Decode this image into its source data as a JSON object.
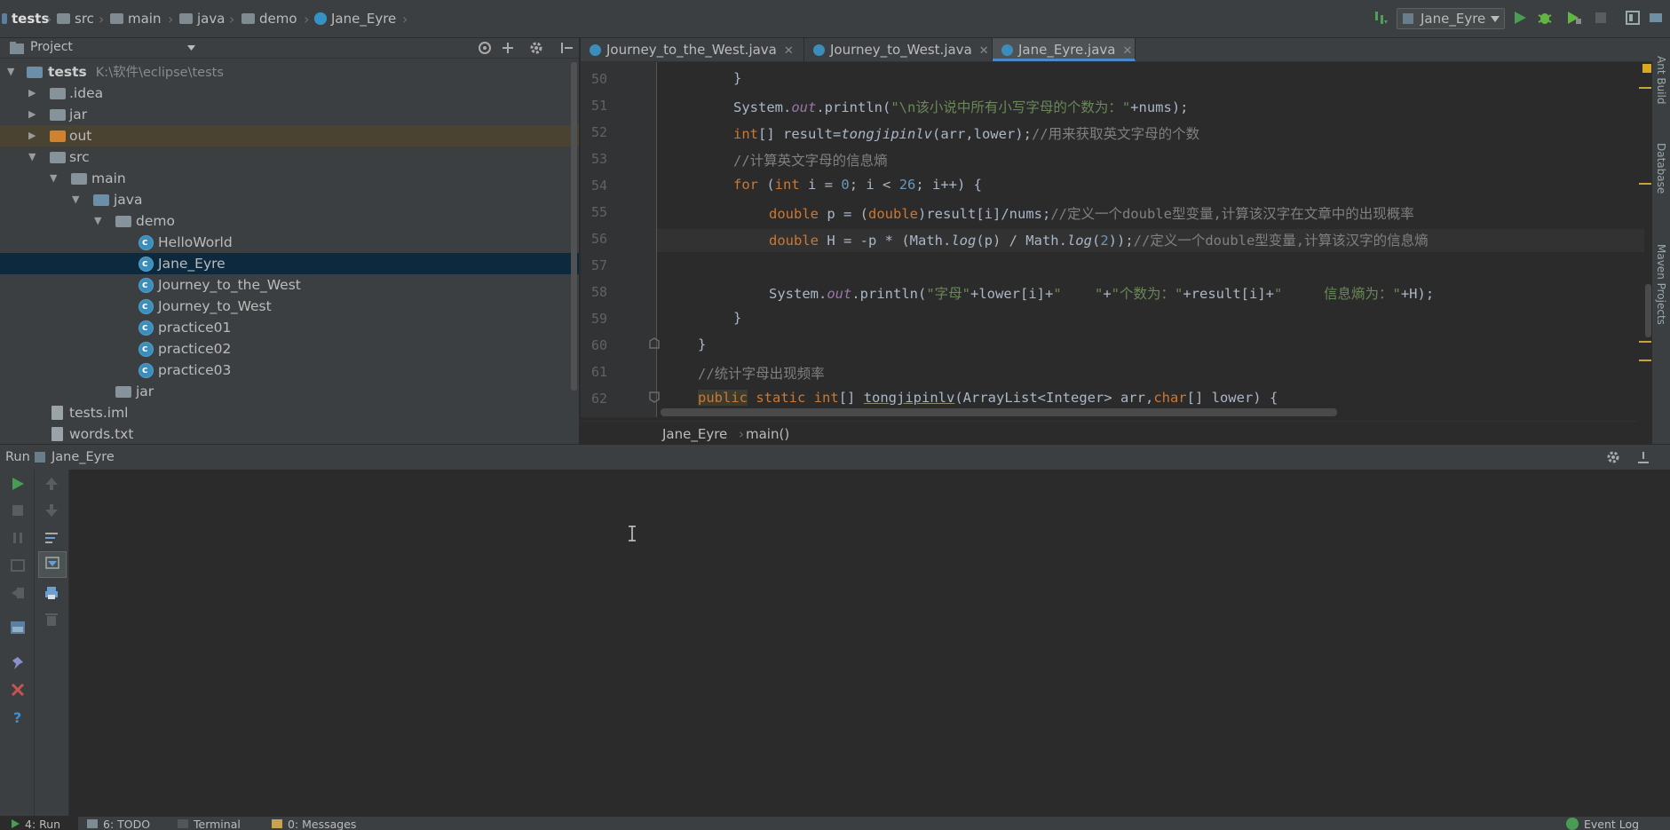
{
  "navbar": {
    "crumbs": [
      "tests",
      "src",
      "main",
      "java",
      "demo",
      "Jane_Eyre"
    ],
    "run_config": "Jane_Eyre"
  },
  "project": {
    "header": "Project",
    "tree": [
      {
        "label": "tests",
        "hint": "K:\\软件\\eclipse\\tests"
      },
      {
        "label": ".idea"
      },
      {
        "label": "jar"
      },
      {
        "label": "out"
      },
      {
        "label": "src"
      },
      {
        "label": "main"
      },
      {
        "label": "java"
      },
      {
        "label": "demo"
      },
      {
        "label": "HelloWorld"
      },
      {
        "label": "Jane_Eyre"
      },
      {
        "label": "Journey_to_the_West"
      },
      {
        "label": "Journey_to_West"
      },
      {
        "label": "practice01"
      },
      {
        "label": "practice02"
      },
      {
        "label": "practice03"
      },
      {
        "label": "jar"
      },
      {
        "label": "tests.iml"
      },
      {
        "label": "words.txt"
      }
    ]
  },
  "tabs": [
    "Journey_to_the_West.java",
    "Journey_to_West.java",
    "Jane_Eyre.java"
  ],
  "editor": {
    "line_numbers": [
      "50",
      "51",
      "52",
      "53",
      "54",
      "55",
      "56",
      "57",
      "58",
      "59",
      "60",
      "61",
      "62"
    ],
    "code": {
      "l50": "}",
      "l51_a": "System.",
      "l51_b": "out",
      "l51_c": ".println(",
      "l51_d": "\"\\n该小说中所有小写字母的个数为：\"",
      "l51_e": "+nums);",
      "l52_a": "int",
      "l52_b": "[] result=",
      "l52_c": "tongjipinlv",
      "l52_d": "(arr,lower);",
      "l52_e": "//用来获取英文字母的个数",
      "l53": "//计算英文字母的信息熵",
      "l54_a": "for",
      "l54_b": " (",
      "l54_c": "int",
      "l54_d": " i = ",
      "l54_e": "0",
      "l54_f": "; i < ",
      "l54_g": "26",
      "l54_h": "; i++) {",
      "l55_a": "double",
      "l55_b": " p = (",
      "l55_c": "double",
      "l55_d": ")result[i]/nums;",
      "l55_e": "//定义一个double型变量,计算该汉字在文章中的出现概率",
      "l56_a": "double",
      "l56_b": " H = -p * (Math.",
      "l56_c": "log",
      "l56_d": "(p) / Math.",
      "l56_e": "log",
      "l56_f": "(",
      "l56_g": "2",
      "l56_h": "));",
      "l56_i": "//定义一个double型变量,计算该汉字的信息熵",
      "l58_a": "System.",
      "l58_b": "out",
      "l58_c": ".println(",
      "l58_d": "\"字母\"",
      "l58_e": "+lower[i]+",
      "l58_f": "\"    \"",
      "l58_g": "+",
      "l58_h": "\"个数为：\"",
      "l58_i": "+result[i]+",
      "l58_j": "\"     信息熵为：\"",
      "l58_k": "+H);",
      "l59": "}",
      "l60": "}",
      "l61": "//统计字母出现频率",
      "l62_a": "public",
      "l62_b": "static",
      "l62_c": "int",
      "l62_d": "[] ",
      "l62_e": "tongjipinlv",
      "l62_f": "(ArrayList<Integer> arr,",
      "l62_g": "char",
      "l62_h": "[] lower) {"
    },
    "breadcrumb": [
      "Jane_Eyre",
      "main()"
    ]
  },
  "run": {
    "label": "Run",
    "config": "Jane_Eyre"
  },
  "statusbar": {
    "tabs": [
      "4: Run",
      "6: TODO",
      "Terminal",
      "0: Messages"
    ],
    "event_log": "Event Log"
  },
  "right_strip": [
    "Ant Build",
    "Database",
    "Maven Projects"
  ],
  "colors": {
    "keyword": "#cc7832",
    "string": "#6a8759",
    "comment": "#808080",
    "number": "#6897bb",
    "field": "#9876aa",
    "selection": "#0d293e"
  }
}
